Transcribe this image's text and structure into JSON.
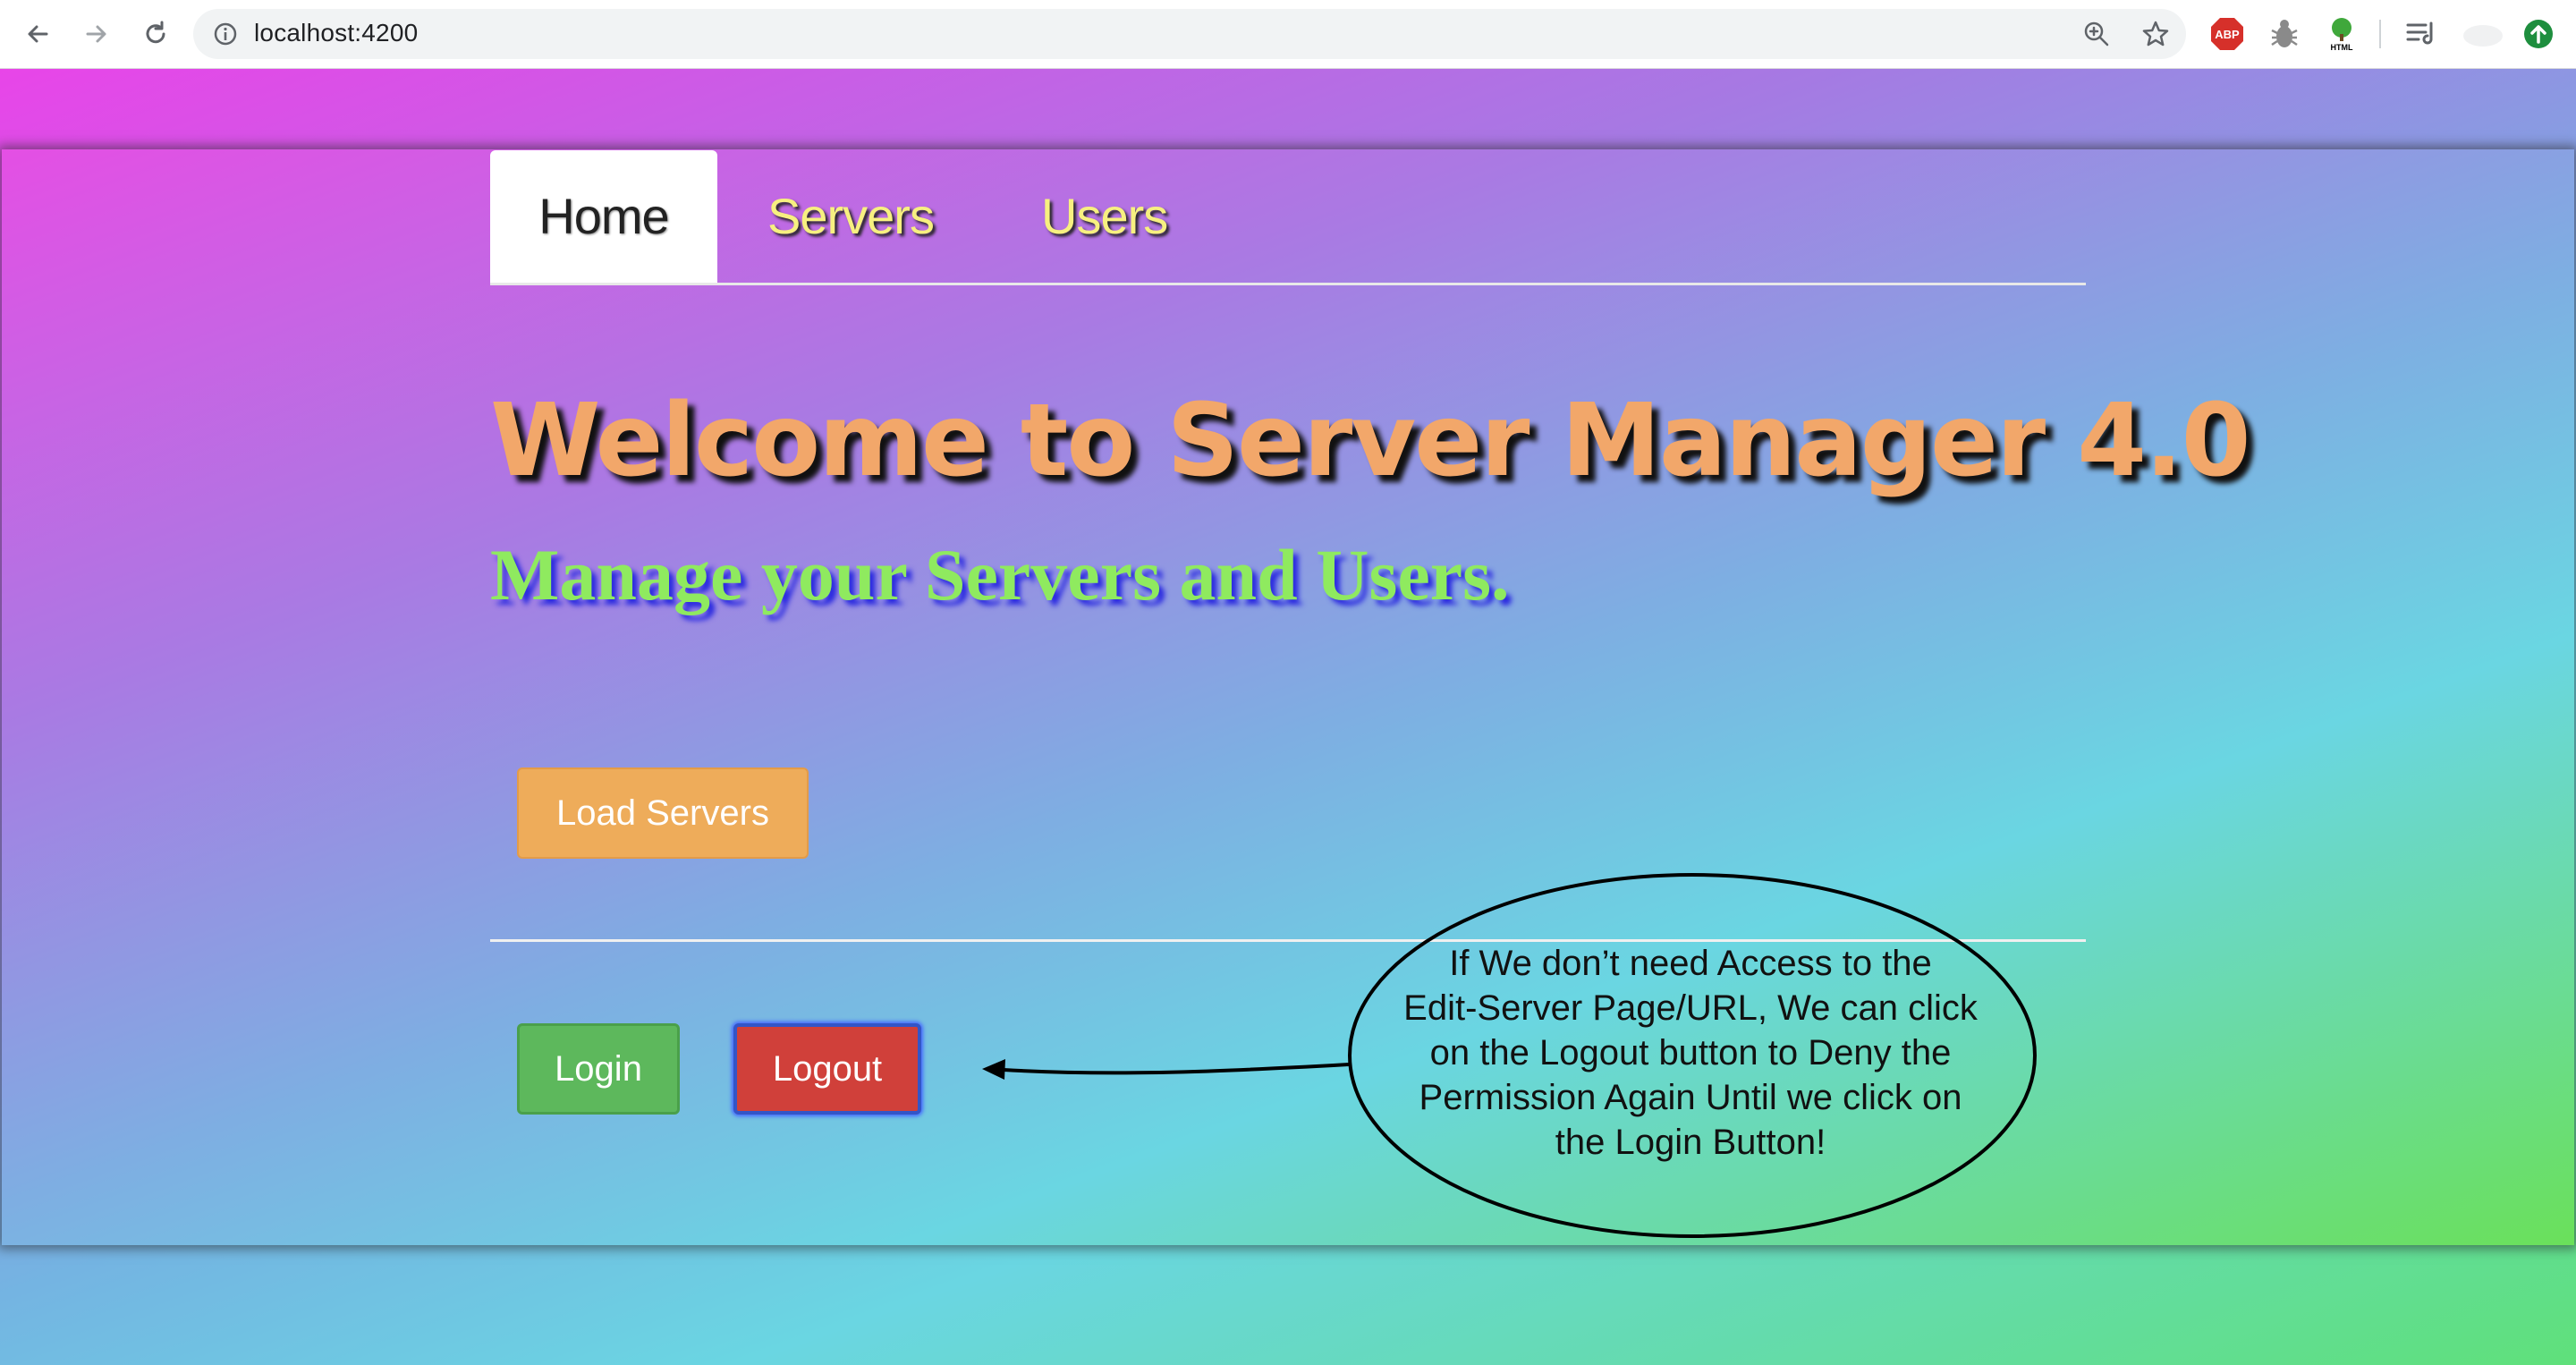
{
  "browser": {
    "url": "localhost:4200",
    "extensions": [
      "adblock-plus-icon",
      "bug-icon",
      "html-tree-icon",
      "reading-list-icon",
      "profile-icon",
      "update-icon"
    ],
    "adblock_label": "ABP",
    "html_label": "HTML"
  },
  "nav": {
    "tabs": [
      {
        "label": "Home",
        "active": true
      },
      {
        "label": "Servers",
        "active": false
      },
      {
        "label": "Users",
        "active": false
      }
    ]
  },
  "hero": {
    "title": "Welcome to Server Manager 4.0",
    "subtitle": "Manage your Servers and Users."
  },
  "actions": {
    "load_servers_label": "Load Servers",
    "login_label": "Login",
    "logout_label": "Logout"
  },
  "annotation": {
    "lines": [
      "If We don’t need Access to the",
      "Edit-Server Page/URL, We can click",
      "on the Logout button to Deny the",
      "Permission Again Until we click on",
      "the Login Button!"
    ]
  },
  "colors": {
    "tab_text": "#f7f080",
    "title": "#f2a76a",
    "subtitle": "#8fea5f",
    "load_button": "#eeac5a",
    "login_button": "#5db85c",
    "logout_button": "#d0403a"
  }
}
